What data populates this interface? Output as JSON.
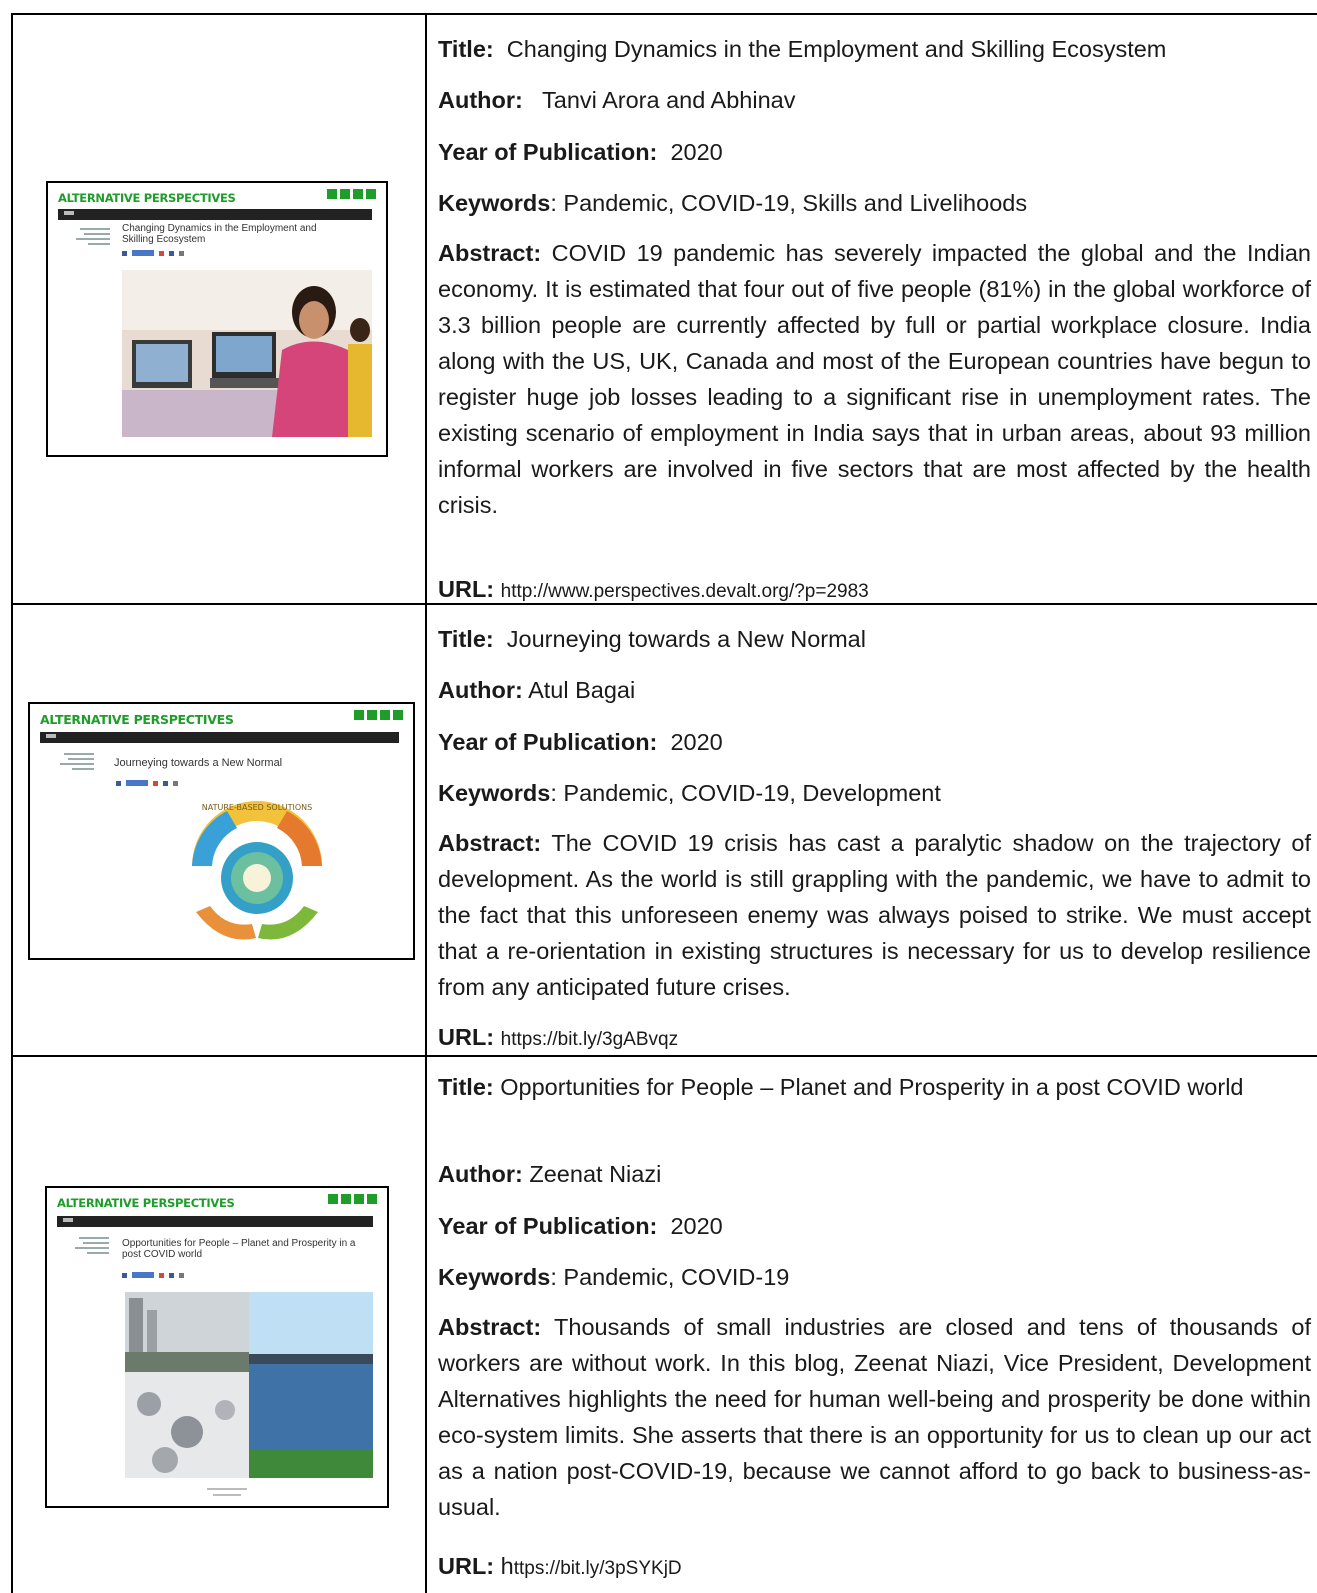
{
  "labels": {
    "title": "Title:",
    "author": "Author:",
    "year": "Year of Publication:",
    "keywords": "Keywords",
    "keywords_colon": ": ",
    "abstract": "Abstract:",
    "url": "URL:"
  },
  "entries": [
    {
      "thumbnail": {
        "brand": "ALTERNATIVE PERSPECTIVES",
        "post_title": "Changing Dynamics in the Employment and Skilling Ecosystem"
      },
      "title": "Changing Dynamics in the Employment and Skilling Ecosystem",
      "author": "Tanvi Arora and Abhinav",
      "year": "2020",
      "keywords": "Pandemic, COVID-19, Skills and Livelihoods",
      "abstract": "COVID 19 pandemic has severely impacted the global and the Indian economy. It is estimated that four out of five people (81%) in the global workforce of 3.3 billion people are currently affected by full or partial workplace closure. India along with the US, UK, Canada and most of the European countries have begun to register huge job losses leading to a significant rise in unemployment rates. The existing scenario of employment in India says that in urban areas, about 93 million informal workers are involved in five sectors that are most affected by the health crisis.",
      "url": "http://www.perspectives.devalt.org/?p=2983"
    },
    {
      "thumbnail": {
        "brand": "ALTERNATIVE PERSPECTIVES",
        "post_title": "Journeying towards a New Normal",
        "graphic_text": "NATURE-BASED SOLUTIONS"
      },
      "title": "Journeying towards a New Normal",
      "author": "Atul Bagai",
      "year": "2020",
      "keywords": "Pandemic, COVID-19, Development",
      "abstract": "The COVID 19 crisis has cast a paralytic shadow on the trajectory of development. As the world is still grappling with the pandemic, we have to admit to the fact that this unforeseen enemy was always poised to strike. We must accept that a re-orientation in existing structures is necessary for us to develop resilience from any anticipated future crises.",
      "url": "https://bit.ly/3gABvqz"
    },
    {
      "thumbnail": {
        "brand": "ALTERNATIVE PERSPECTIVES",
        "post_title": "Opportunities for People – Planet and Prosperity in a post COVID world"
      },
      "title": "Opportunities for People – Planet and Prosperity in a post COVID world",
      "author": "Zeenat Niazi",
      "year": "2020",
      "keywords": "Pandemic, COVID-19",
      "abstract": "Thousands of small industries are closed and tens of thousands of workers are without work. In this blog, Zeenat Niazi, Vice President, Development Alternatives highlights the need for human well-being and prosperity be done within eco-system limits. She asserts that there is an opportunity for us to clean up our act as a nation post-COVID-19, because we cannot afford to go back to business-as-usual.",
      "url_first": "h",
      "url_rest": "ttps://bit.ly/3pSYKjD"
    }
  ]
}
